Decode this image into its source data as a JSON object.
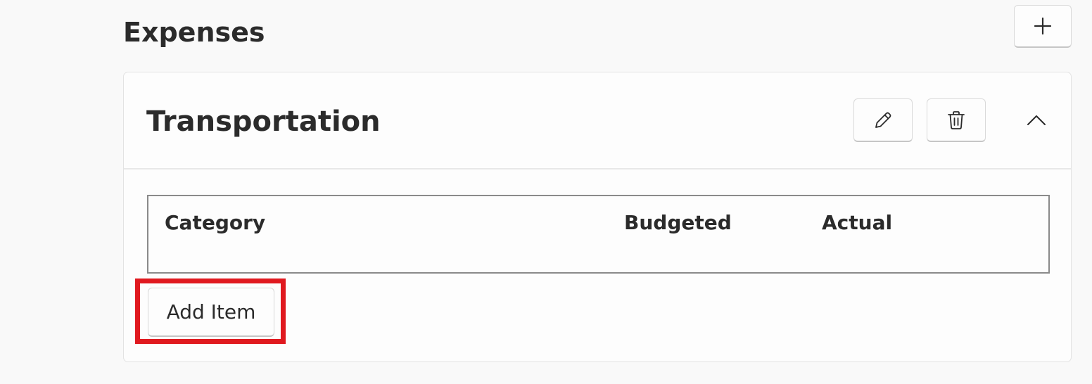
{
  "section": {
    "title": "Expenses",
    "add_icon": "plus-icon"
  },
  "category_card": {
    "title": "Transportation",
    "edit_icon": "pencil-icon",
    "delete_icon": "trash-icon",
    "collapse_icon": "chevron-up-icon",
    "table": {
      "columns": [
        "Category",
        "Budgeted",
        "Actual"
      ],
      "rows": []
    },
    "add_item_label": "Add Item"
  },
  "colors": {
    "highlight": "#e0191f",
    "text": "#2b2b2b",
    "background": "#f9f9f9",
    "card": "#fdfdfd"
  }
}
